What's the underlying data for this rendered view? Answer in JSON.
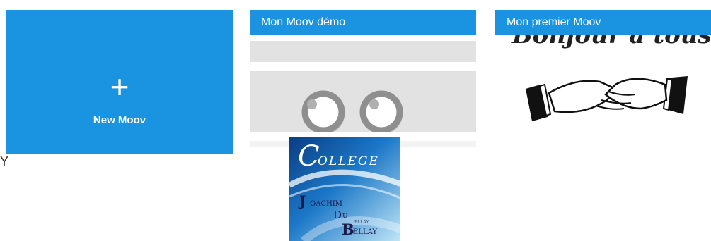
{
  "new_moov": {
    "plus_symbol": "+",
    "label": "New Moov"
  },
  "stray_text": "Y",
  "cards": [
    {
      "title": "Mon Moov démo"
    },
    {
      "title": "Mon premier Moov",
      "image_text": "Bonjour à tous"
    }
  ],
  "logo": {
    "letter_c": "C",
    "ollege": "OLLEGE",
    "letter_j": "J",
    "oachim": "OACHIM",
    "letter_d": "D",
    "u": "U",
    "small_ellay": "ELLAY",
    "letter_b": "B",
    "ellay": "ELLAY"
  },
  "colors": {
    "accent": "#1a93e0",
    "card_text": "#ffffff",
    "placeholder_gray": "#e2e2e2"
  },
  "icons": {
    "new_moov": "plus-icon",
    "demo_thumbnail": "eyes-icon",
    "first_thumbnail": "handshake-icon"
  }
}
